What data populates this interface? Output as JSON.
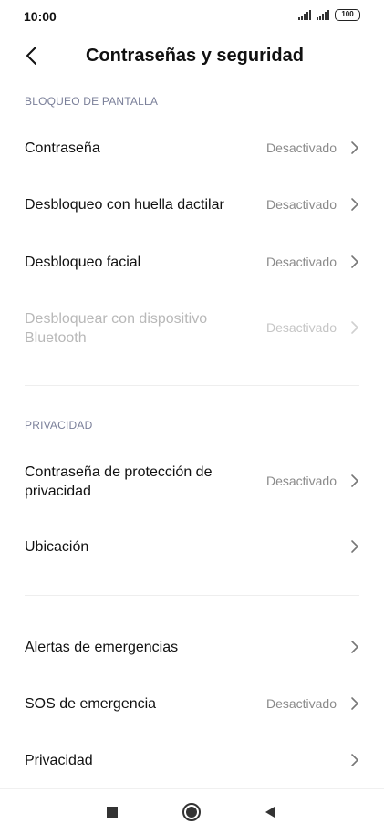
{
  "status_bar": {
    "time": "10:00",
    "battery": "100"
  },
  "header": {
    "title": "Contraseñas y seguridad"
  },
  "sections": {
    "screen_lock": {
      "label": "BLOQUEO DE PANTALLA",
      "items": [
        {
          "label": "Contraseña",
          "value": "Desactivado"
        },
        {
          "label": "Desbloqueo con huella dactilar",
          "value": "Desactivado"
        },
        {
          "label": "Desbloqueo facial",
          "value": "Desactivado"
        },
        {
          "label": "Desbloquear con dispositivo Bluetooth",
          "value": "Desactivado",
          "disabled": true
        }
      ]
    },
    "privacy": {
      "label": "PRIVACIDAD",
      "items": [
        {
          "label": "Contraseña de protección de privacidad",
          "value": "Desactivado"
        },
        {
          "label": "Ubicación",
          "value": ""
        }
      ]
    },
    "other": {
      "items": [
        {
          "label": "Alertas de emergencias",
          "value": ""
        },
        {
          "label": "SOS de emergencia",
          "value": "Desactivado"
        },
        {
          "label": "Privacidad",
          "value": ""
        }
      ]
    }
  },
  "colors": {
    "section_label": "#7a7f99",
    "value_text": "#8a8a8a",
    "disabled_text": "#b8b8b8",
    "chevron": "#777777"
  },
  "icons": {
    "back": "chevron-left-icon",
    "row_arrow": "chevron-right-icon",
    "nav_recents": "square-icon",
    "nav_home": "circle-icon",
    "nav_back": "triangle-left-icon"
  }
}
